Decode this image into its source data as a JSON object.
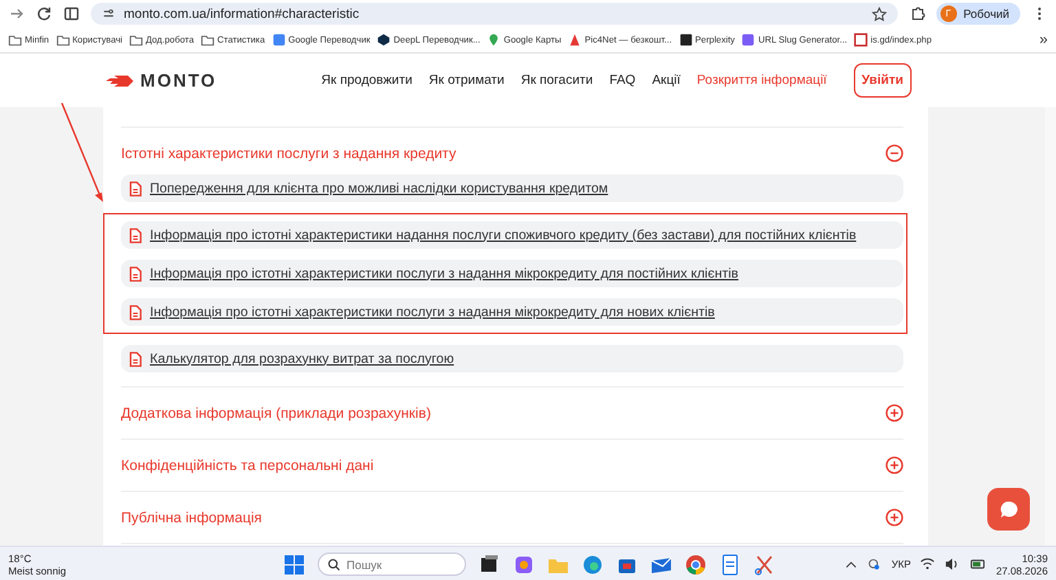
{
  "browser": {
    "url": "monto.com.ua/information#characteristic",
    "profile_initial": "Г",
    "profile_name": "Робочий",
    "bookmarks": [
      {
        "kind": "folder",
        "label": "Minfin"
      },
      {
        "kind": "folder",
        "label": "Користувачі"
      },
      {
        "kind": "folder",
        "label": "Дод.робота"
      },
      {
        "kind": "folder",
        "label": "Статистика"
      },
      {
        "kind": "translate",
        "label": "Google Переводчик"
      },
      {
        "kind": "deepl",
        "label": "DeepL Переводчик..."
      },
      {
        "kind": "maps",
        "label": "Google Карты"
      },
      {
        "kind": "pic",
        "label": "Pic4Net — безкошт..."
      },
      {
        "kind": "perplexity",
        "label": "Perplexity"
      },
      {
        "kind": "slug",
        "label": "URL Slug Generator..."
      },
      {
        "kind": "isgd",
        "label": "is.gd/index.php"
      }
    ],
    "more": "»"
  },
  "site": {
    "logo": "MONTO",
    "nav": [
      {
        "label": "Як продовжити",
        "selected": false
      },
      {
        "label": "Як отримати",
        "selected": false
      },
      {
        "label": "Як погасити",
        "selected": false
      },
      {
        "label": "FAQ",
        "selected": false
      },
      {
        "label": "Акції",
        "selected": false
      },
      {
        "label": "Розкриття інформації",
        "selected": true
      }
    ],
    "login": "Увійти"
  },
  "sections": [
    {
      "title": "Істотні характеристики послуги з надання кредиту",
      "expanded": true,
      "docs": [
        {
          "label": "Попередження для клієнта про можливі наслідки користування кредитом",
          "highlighted": false
        },
        {
          "label": "Інформація про істотні характеристики надання послуги споживчого кредиту (без застави) для постійних клієнтів",
          "highlighted": true
        },
        {
          "label": "Інформація про істотні характеристики послуги з надання мікрокредиту для постійних клієнтів",
          "highlighted": true
        },
        {
          "label": "Інформація про істотні характеристики послуги з надання мікрокредиту для нових клієнтів",
          "highlighted": true
        },
        {
          "label": "Калькулятор для розрахунку витрат за послугою",
          "highlighted": false
        }
      ]
    },
    {
      "title": "Додаткова інформація (приклади розрахунків)",
      "expanded": false
    },
    {
      "title": "Конфіденційність та персональні дані",
      "expanded": false
    },
    {
      "title": "Публічна інформація",
      "expanded": false
    }
  ],
  "taskbar": {
    "temperature": "18°C",
    "weather": "Meist sonnig",
    "search_placeholder": "Пошук",
    "language": "УКР",
    "time": "10:39",
    "date": "27.08.2026"
  }
}
